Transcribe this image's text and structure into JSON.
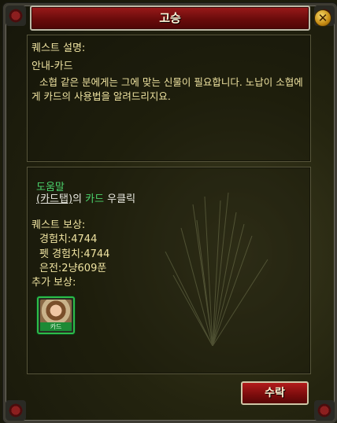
{
  "window": {
    "title": "고승",
    "close_symbol": "✕"
  },
  "description": {
    "heading": "퀘스트 설명:",
    "quest_name": "안내-카드",
    "text": "소협 같은 분에게는 그에 맞는 신물이 필요합니다. 노납이 소협에게 카드의 사용법을 알려드리지요."
  },
  "help": {
    "label": "도움말",
    "link_text": "(카드탭)",
    "text_mid": "의 ",
    "keyword": "카드",
    "text_end": " 우클릭"
  },
  "rewards": {
    "heading": "퀘스트 보상:",
    "exp": "경험치:4744",
    "pet_exp": "펫 경험치:4744",
    "money": "은전:2냥609푼"
  },
  "extra_rewards": {
    "heading": "추가 보상:",
    "item_icon": "portrait-card-icon",
    "item_tag": "카드"
  },
  "buttons": {
    "accept": "수락"
  }
}
